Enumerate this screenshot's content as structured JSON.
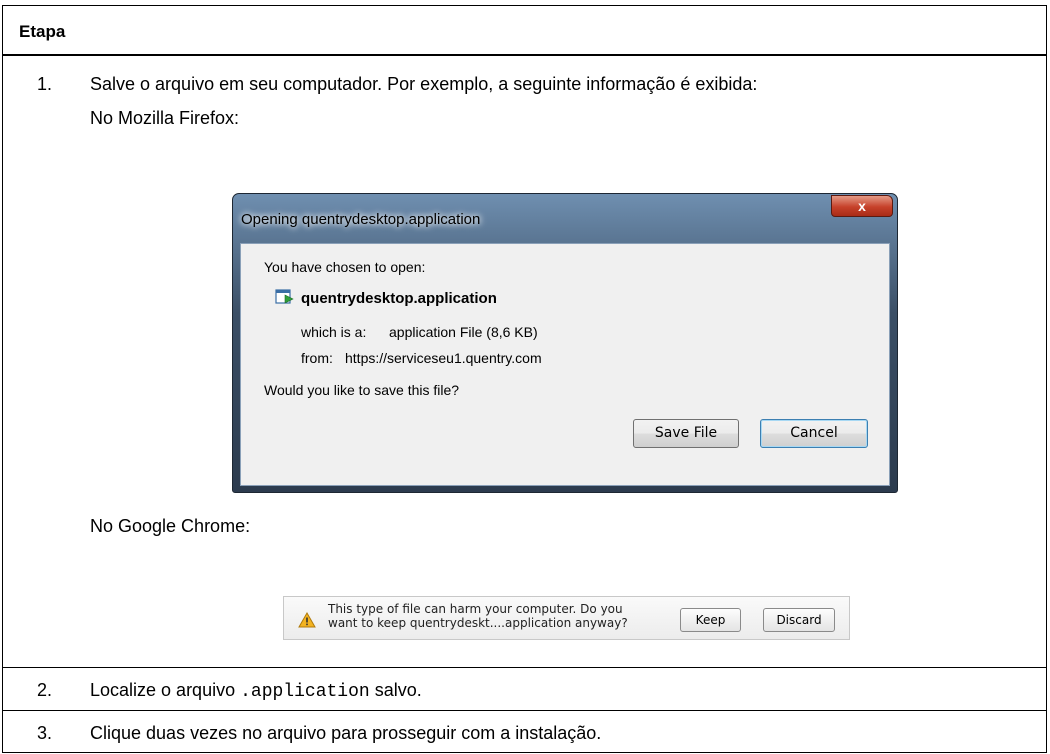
{
  "table": {
    "header": "Etapa",
    "steps": [
      {
        "number": "1.",
        "text": "Salve o arquivo em seu computador. Por exemplo, a seguinte informação é exibida:",
        "firefox_label": "No Mozilla Firefox:",
        "chrome_label": "No Google Chrome:"
      },
      {
        "number": "2.",
        "text_before": "Localize o arquivo ",
        "code": ".application",
        "text_after": " salvo."
      },
      {
        "number": "3.",
        "text": "Clique duas vezes no arquivo para prosseguir com a instalação."
      }
    ]
  },
  "firefox_dialog": {
    "title": "Opening quentrydesktop.application",
    "close_label": "x",
    "intro": "You have chosen to open:",
    "filename": "quentrydesktop.application",
    "which_is_label": "which is a:",
    "which_is_value": "application File (8,6 KB)",
    "from_label": "from:",
    "from_value": "https://serviceseu1.quentry.com",
    "question": "Would you like to save this file?",
    "save_button": "Save File",
    "cancel_button": "Cancel"
  },
  "chrome_bar": {
    "line1": "This type of file can harm your computer. Do you",
    "line2": "want to keep quentrydeskt....application anyway?",
    "keep_button": "Keep",
    "discard_button": "Discard",
    "icon": "warning-icon"
  }
}
